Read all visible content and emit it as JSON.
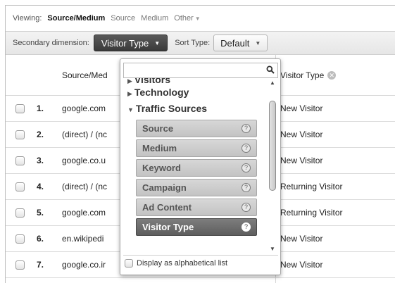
{
  "viewing": {
    "label": "Viewing:",
    "options": [
      {
        "label": "Source/Medium",
        "active": true
      },
      {
        "label": "Source",
        "active": false
      },
      {
        "label": "Medium",
        "active": false
      },
      {
        "label": "Other",
        "active": false
      }
    ]
  },
  "secondary": {
    "label": "Secondary dimension:",
    "selected": "Visitor Type",
    "sort_label": "Sort Type:",
    "sort_value": "Default"
  },
  "table": {
    "col_source": "Source/Med",
    "col_visitor_type": "Visitor Type",
    "rows": [
      {
        "num": "1.",
        "source": "google.com",
        "vt": "New Visitor"
      },
      {
        "num": "2.",
        "source": "(direct) / (nc",
        "vt": "New Visitor"
      },
      {
        "num": "3.",
        "source": "google.co.u",
        "vt": "New Visitor"
      },
      {
        "num": "4.",
        "source": "(direct) / (nc",
        "vt": "Returning Visitor"
      },
      {
        "num": "5.",
        "source": "google.com",
        "vt": "Returning Visitor"
      },
      {
        "num": "6.",
        "source": "en.wikipedi",
        "vt": "New Visitor"
      },
      {
        "num": "7.",
        "source": "google.co.ir",
        "vt": "New Visitor"
      }
    ]
  },
  "dropdown": {
    "search_placeholder": "",
    "categories": {
      "visitors": "Visitors",
      "technology": "Technology",
      "traffic_sources": "Traffic Sources"
    },
    "items": [
      {
        "label": "Source",
        "selected": false
      },
      {
        "label": "Medium",
        "selected": false
      },
      {
        "label": "Keyword",
        "selected": false
      },
      {
        "label": "Campaign",
        "selected": false
      },
      {
        "label": "Ad Content",
        "selected": false
      },
      {
        "label": "Visitor Type",
        "selected": true
      }
    ],
    "help_glyph": "?",
    "alpha_label": "Display as alphabetical list"
  },
  "glyphs": {
    "caret": "▼",
    "remove": "✕",
    "expanded": "▼",
    "collapsed": "▶",
    "up": "▲",
    "down": "▼"
  }
}
